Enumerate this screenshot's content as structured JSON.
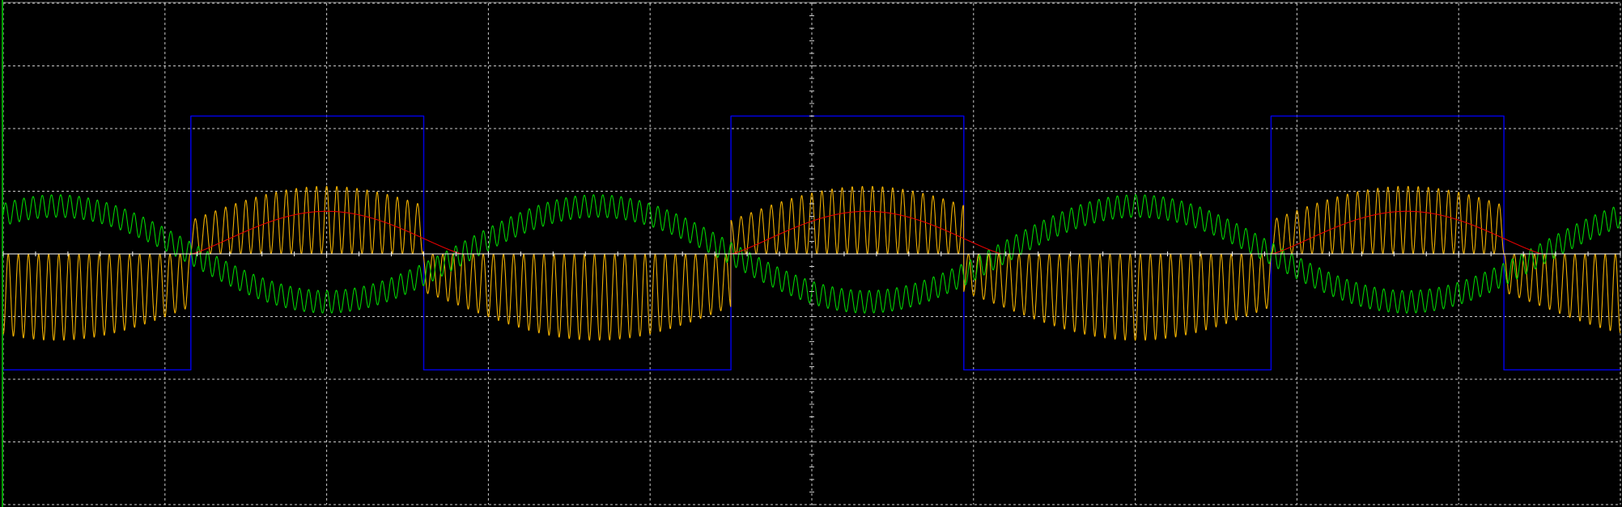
{
  "chart_data": {
    "type": "line",
    "title": "",
    "xlabel": "",
    "ylabel": "",
    "grid": true,
    "legend": "none",
    "xlim": [
      0,
      10
    ],
    "ylim": [
      -4,
      4
    ],
    "grid_divisions": {
      "x": 10,
      "y": 8
    },
    "minor_ticks_per_division": 5,
    "colors": {
      "background": "#000000",
      "grid": "#c8c8c8",
      "axis": "#ffffff",
      "left_border": "#00a000"
    },
    "series": [
      {
        "color": "#0000e0",
        "shape": "square",
        "high": 2.2,
        "low": -1.85,
        "rising_edges": [
          1.16,
          4.5,
          7.84
        ],
        "falling_edges": [
          2.6,
          5.94,
          9.28
        ]
      },
      {
        "color": "#f0b000",
        "shape": "am-carrier-with-envelope-phase-flip",
        "envelope_max": 1.1,
        "envelope_min": 0.0,
        "envelope_period": 3.34,
        "envelope_peak_at": 2.0,
        "carrier_cycles_per_division": 16,
        "sign_flip_at_edges": true
      },
      {
        "color": "#00d000",
        "shape": "am-carrier-complementary",
        "envelope_max": 0.45,
        "envelope_min": 0.0,
        "envelope_period": 3.34,
        "envelope_peak_at": 0.33,
        "carrier_cycles_per_division": 16,
        "baseline": 0.0
      },
      {
        "color": "#e00000",
        "shape": "demodulated-envelope",
        "peak": 0.68,
        "min": 0.0,
        "period": 3.34,
        "peak_at": 2.0
      }
    ]
  }
}
